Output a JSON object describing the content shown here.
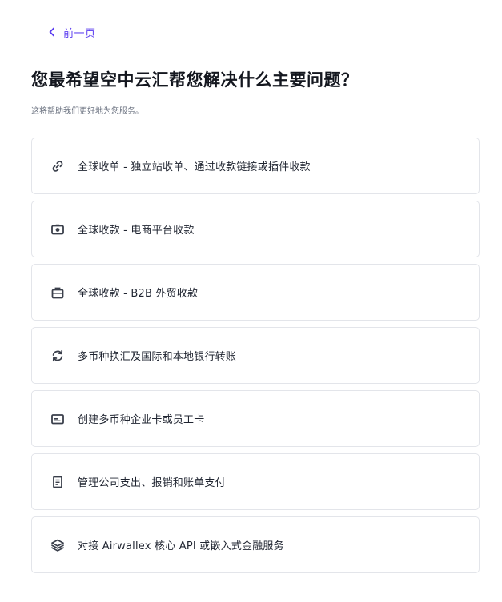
{
  "back": {
    "label": "前一页"
  },
  "question": {
    "title": "您最希望空中云汇帮您解决什么主要问题？",
    "subtitle": "这将帮助我们更好地为您服务。"
  },
  "options": [
    {
      "icon": "link-icon",
      "label": "全球收单 - 独立站收单、通过收款链接或插件收款"
    },
    {
      "icon": "camera-icon",
      "label": "全球收款 - 电商平台收款"
    },
    {
      "icon": "briefcase-icon",
      "label": "全球收款 - B2B 外贸收款"
    },
    {
      "icon": "exchange-icon",
      "label": "多币种换汇及国际和本地银行转账"
    },
    {
      "icon": "card-icon",
      "label": "创建多币种企业卡或员工卡"
    },
    {
      "icon": "document-icon",
      "label": "管理公司支出、报销和账单支付"
    },
    {
      "icon": "layers-icon",
      "label": "对接 Airwallex 核心 API 或嵌入式金融服务"
    }
  ],
  "colors": {
    "accent": "#5b3df0",
    "text": "#1f2430",
    "muted": "#6b7280",
    "border": "#e3e5ea"
  }
}
